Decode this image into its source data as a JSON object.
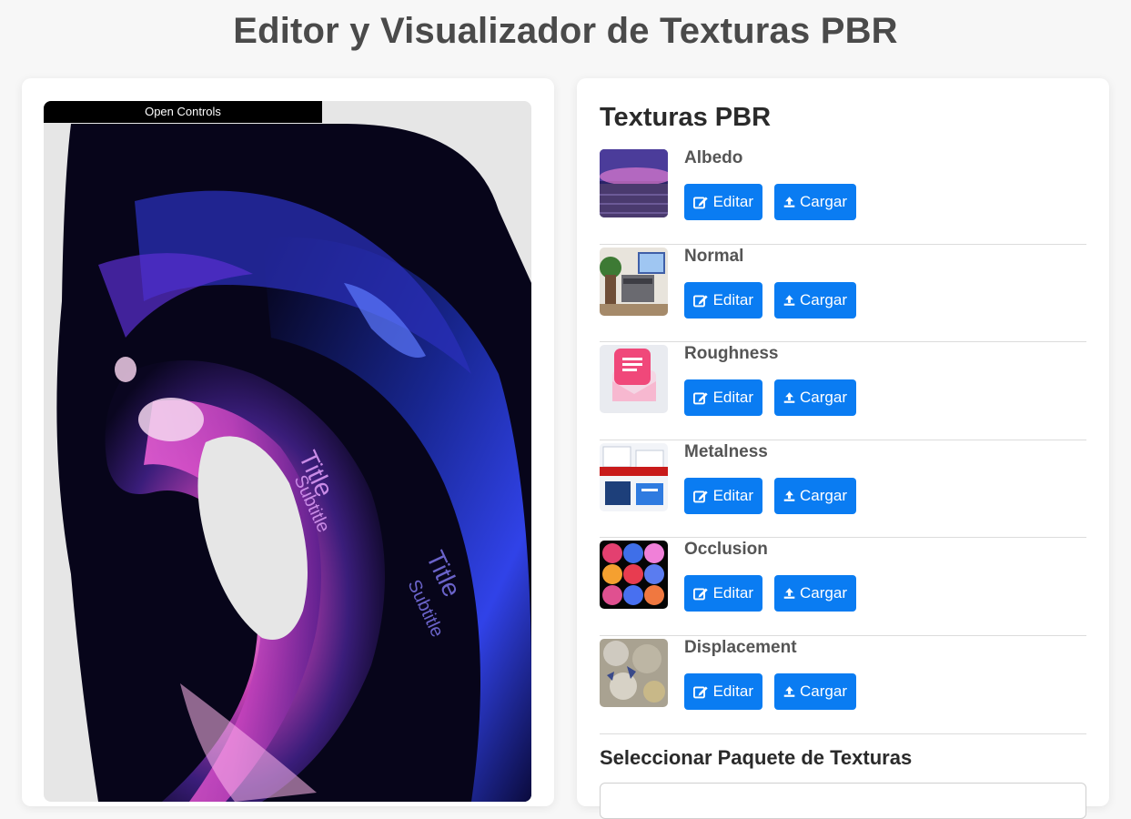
{
  "page": {
    "title": "Editor y Visualizador de Texturas PBR"
  },
  "viewer": {
    "open_controls_label": "Open Controls",
    "scene_texts": [
      "Title",
      "Subtitle",
      "Title",
      "Subtitle"
    ]
  },
  "textures": {
    "heading": "Texturas PBR",
    "edit_label": "Editar",
    "load_label": "Cargar",
    "items": [
      {
        "name": "Albedo"
      },
      {
        "name": "Normal"
      },
      {
        "name": "Roughness"
      },
      {
        "name": "Metalness"
      },
      {
        "name": "Occlusion"
      },
      {
        "name": "Displacement"
      }
    ]
  },
  "pack": {
    "heading": "Seleccionar Paquete de Texturas"
  },
  "colors": {
    "accent": "#0a7cf2",
    "title": "#4a4a4a"
  }
}
